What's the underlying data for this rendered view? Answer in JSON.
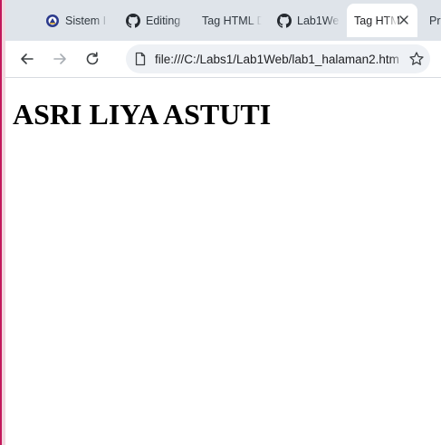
{
  "tabs": [
    {
      "label": "Sistem I",
      "icon": "university-logo-icon",
      "active": false
    },
    {
      "label": "Editing",
      "icon": "github-icon",
      "active": false
    },
    {
      "label": "Tag HTML D",
      "icon": "none",
      "active": false
    },
    {
      "label": "Lab1We",
      "icon": "github-icon",
      "active": false
    },
    {
      "label": "Tag HTM",
      "icon": "none",
      "active": true
    },
    {
      "label": "Pra",
      "icon": "none",
      "active": false
    }
  ],
  "toolbar": {
    "back_icon": "back-arrow-icon",
    "forward_icon": "forward-arrow-icon",
    "reload_icon": "reload-icon",
    "url": "file:///C:/Labs1/Lab1Web/lab1_halaman2.htm",
    "page_icon": "document-icon",
    "bookmark_icon": "star-icon"
  },
  "page": {
    "heading": "ASRI LIYA ASTUTI"
  },
  "colors": {
    "tab_strip": "#dfe4ea",
    "active_tab": "#ffffff",
    "omnibox": "#eef1f5",
    "window_edge": "#c2185b"
  }
}
